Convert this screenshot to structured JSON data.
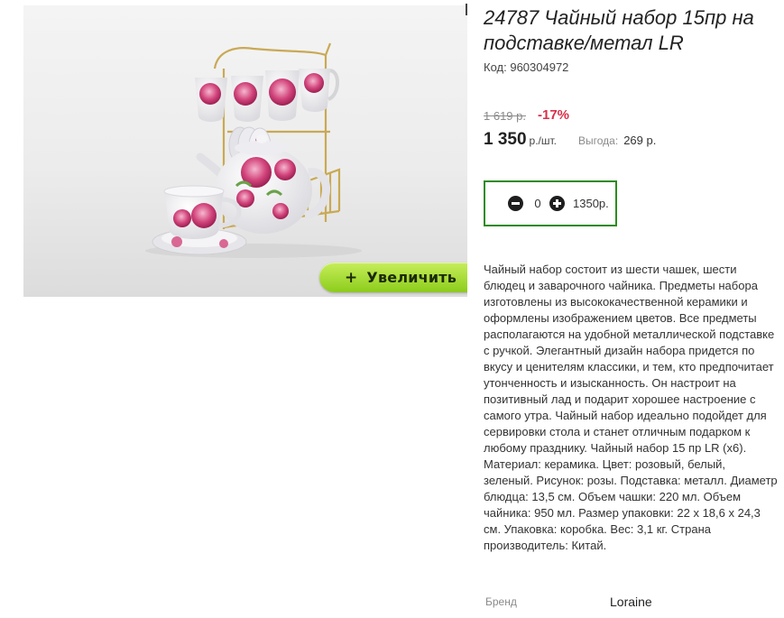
{
  "product": {
    "title": "24787 Чайный набор 15пр на подставке/метал LR",
    "code_label": "Код:",
    "code_value": "960304972",
    "image_alt": "tea-set-product-photo"
  },
  "zoom": {
    "label": "Увеличить",
    "icon": "plus-icon"
  },
  "pricing": {
    "old_price": "1 619 р.",
    "discount": "-17%",
    "price": "1 350",
    "price_unit": "р./шт.",
    "savings_label": "Выгода:",
    "savings_value": "269 р."
  },
  "cart": {
    "quantity": "0",
    "total": "1350р.",
    "minus_icon": "minus-circle-icon",
    "plus_icon": "plus-circle-icon"
  },
  "description": "Чайный набор состоит из шести чашек, шести блюдец и заварочного чайника. Предметы набора изготовлены из высококачественной керамики и оформлены изображением цветов. Все предметы располагаются на удобной металлической подставке с ручкой. Элегантный дизайн набора придется по вкусу и ценителям классики, и тем, кто предпочитает утонченность и изысканность. Он настроит на позитивный лад и подарит хорошее настроение с самого утра. Чайный набор идеально подойдет для сервировки стола и станет отличным подарком к любому празднику. Чайный набор 15 пр LR (x6). Материал: керамика. Цвет: розовый, белый, зеленый. Рисунок: розы. Подставка: металл. Диаметр блюдца: 13,5 см. Объем чашки: 220 мл. Объем чайника: 950 мл. Размер упаковки: 22 х 18,6 х 24,3 см. Упаковка: коробка. Вес: 3,1 кг. Страна производитель: Китай.",
  "brand": {
    "label": "Бренд",
    "value": "Loraine"
  },
  "colors": {
    "accent_green": "#2e8b1e",
    "discount_red": "#d9304a",
    "zoom_button": "#a6dc33"
  }
}
